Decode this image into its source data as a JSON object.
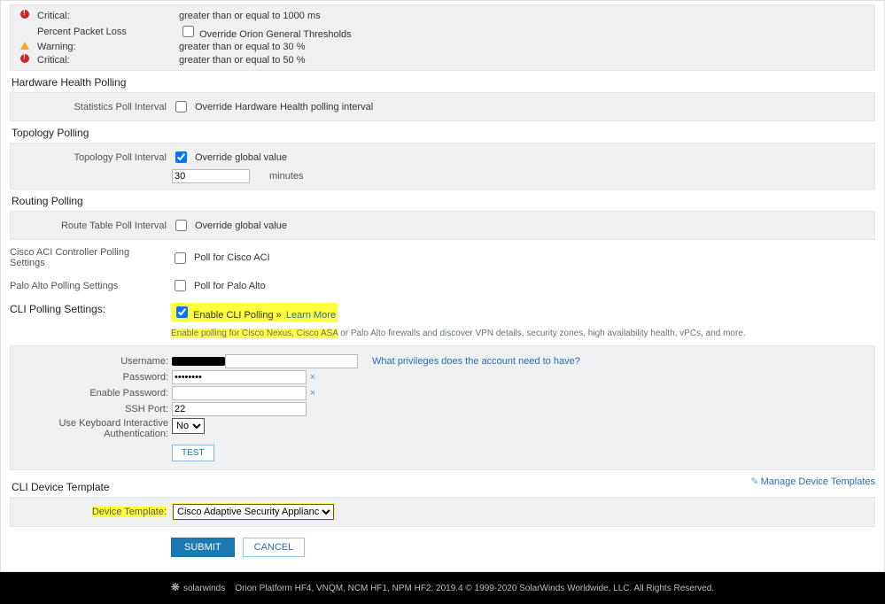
{
  "thresholds": {
    "rt_critical_name": "Critical:",
    "rt_critical_val": "greater than or equal to 1000 ms",
    "ppl_name": "Percent Packet Loss",
    "ppl_override": "Override Orion General Thresholds",
    "ppl_warning_name": "Warning:",
    "ppl_warning_val": "greater than or equal to 30 %",
    "ppl_critical_name": "Critical:",
    "ppl_critical_val": "greater than or equal to 50 %"
  },
  "hw": {
    "title": "Hardware Health Polling",
    "label": "Statistics Poll Interval",
    "override": "Override Hardware Health polling interval"
  },
  "topology": {
    "title": "Topology Polling",
    "label": "Topology Poll Interval",
    "override": "Override global value",
    "value": "30",
    "unit": "minutes"
  },
  "routing": {
    "title": "Routing Polling",
    "label": "Route Table Poll Interval",
    "override": "Override global value"
  },
  "aci": {
    "title": "Cisco ACI Controller Polling Settings",
    "cb": "Poll for Cisco ACI"
  },
  "pa": {
    "title": "Palo Alto Polling Settings",
    "cb": "Poll for Palo Alto"
  },
  "cli": {
    "title": "CLI Polling Settings:",
    "enable": "Enable CLI Polling",
    "learn": "Learn More",
    "help1": "Enable polling for Cisco Nexus, Cisco ASA",
    "help2": " or Palo Alto firewalls and discover VPN details, security zones, high availability health, vPCs, and more.",
    "username": "Username:",
    "password": "Password:",
    "enablepw": "Enable Password:",
    "sshport": "SSH Port:",
    "sshport_val": "22",
    "kbauth1": "Use Keyboard Interactive",
    "kbauth2": "Authentication:",
    "kb_val": "No",
    "test": "TEST",
    "priv": "What privileges does the account need to have?"
  },
  "tpl": {
    "title": "CLI Device Template",
    "label": "Device Template:",
    "value": "Cisco Adaptive Security Appliance",
    "manage": "Manage Device Templates"
  },
  "buttons": {
    "submit": "SUBMIT",
    "cancel": "CANCEL"
  },
  "footer": {
    "brand": "solarwinds",
    "text": "Orion Platform HF4, VNQM, NCM HF1, NPM HF2: 2019.4 © 1999-2020 SolarWinds Worldwide, LLC. All Rights Reserved."
  }
}
